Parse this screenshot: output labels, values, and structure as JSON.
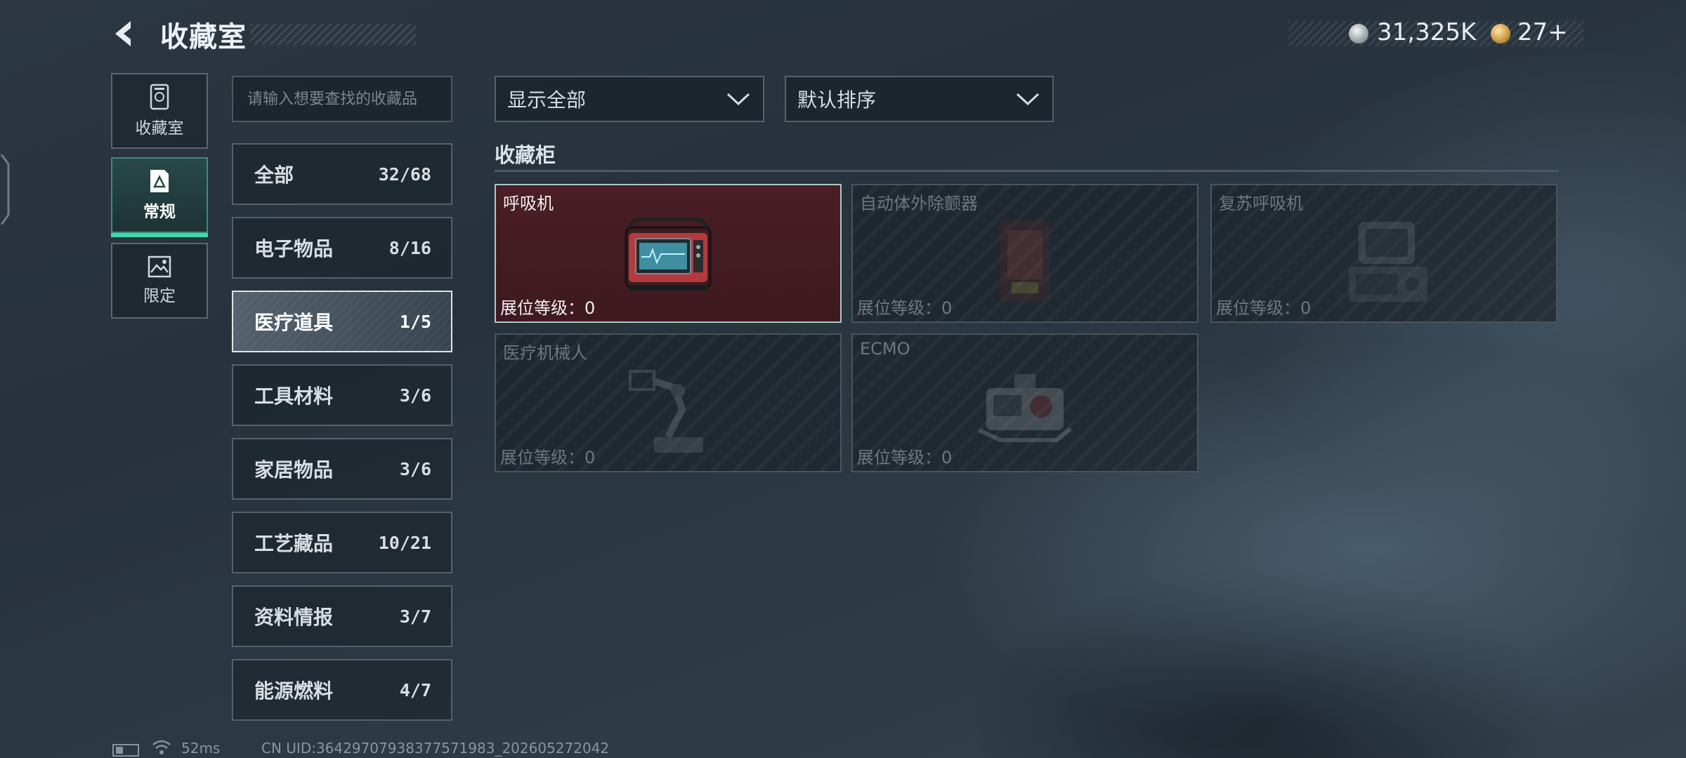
{
  "header": {
    "title": "收藏室",
    "currencies": [
      {
        "icon": "silver-coin-icon",
        "value": "31,325K"
      },
      {
        "icon": "gold-coin-icon",
        "value": "27+"
      }
    ]
  },
  "side_nav": [
    {
      "label": "收藏室",
      "icon": "vault-icon",
      "active": false
    },
    {
      "label": "常规",
      "icon": "document-icon",
      "active": true
    },
    {
      "label": "限定",
      "icon": "picture-icon",
      "active": false
    }
  ],
  "search": {
    "placeholder": "请输入想要查找的收藏品",
    "value": ""
  },
  "categories": [
    {
      "name": "全部",
      "count": "32/68"
    },
    {
      "name": "电子物品",
      "count": "8/16"
    },
    {
      "name": "医疗道具",
      "count": "1/5",
      "active": true
    },
    {
      "name": "工具材料",
      "count": "3/6"
    },
    {
      "name": "家居物品",
      "count": "3/6"
    },
    {
      "name": "工艺藏品",
      "count": "10/21"
    },
    {
      "name": "资料情报",
      "count": "3/7"
    },
    {
      "name": "能源燃料",
      "count": "4/7"
    }
  ],
  "filters": {
    "display": "显示全部",
    "sort": "默认排序"
  },
  "section": {
    "title": "收藏柜"
  },
  "items": [
    {
      "name": "呼吸机",
      "level": "展位等级：0",
      "owned": true
    },
    {
      "name": "自动体外除颤器",
      "level": "展位等级：0",
      "owned": false
    },
    {
      "name": "复苏呼吸机",
      "level": "展位等级：0",
      "owned": false
    },
    {
      "name": "医疗机械人",
      "level": "展位等级：0",
      "owned": false
    },
    {
      "name": "ECMO",
      "level": "展位等级：0",
      "owned": false
    }
  ],
  "status_bar": {
    "ping": "52ms",
    "uid": "CN UID:36429707938377571983_202605272042"
  },
  "colors": {
    "accent": "#3ddba9",
    "owned_card": "#4a1e26",
    "background": "#2b3640"
  }
}
